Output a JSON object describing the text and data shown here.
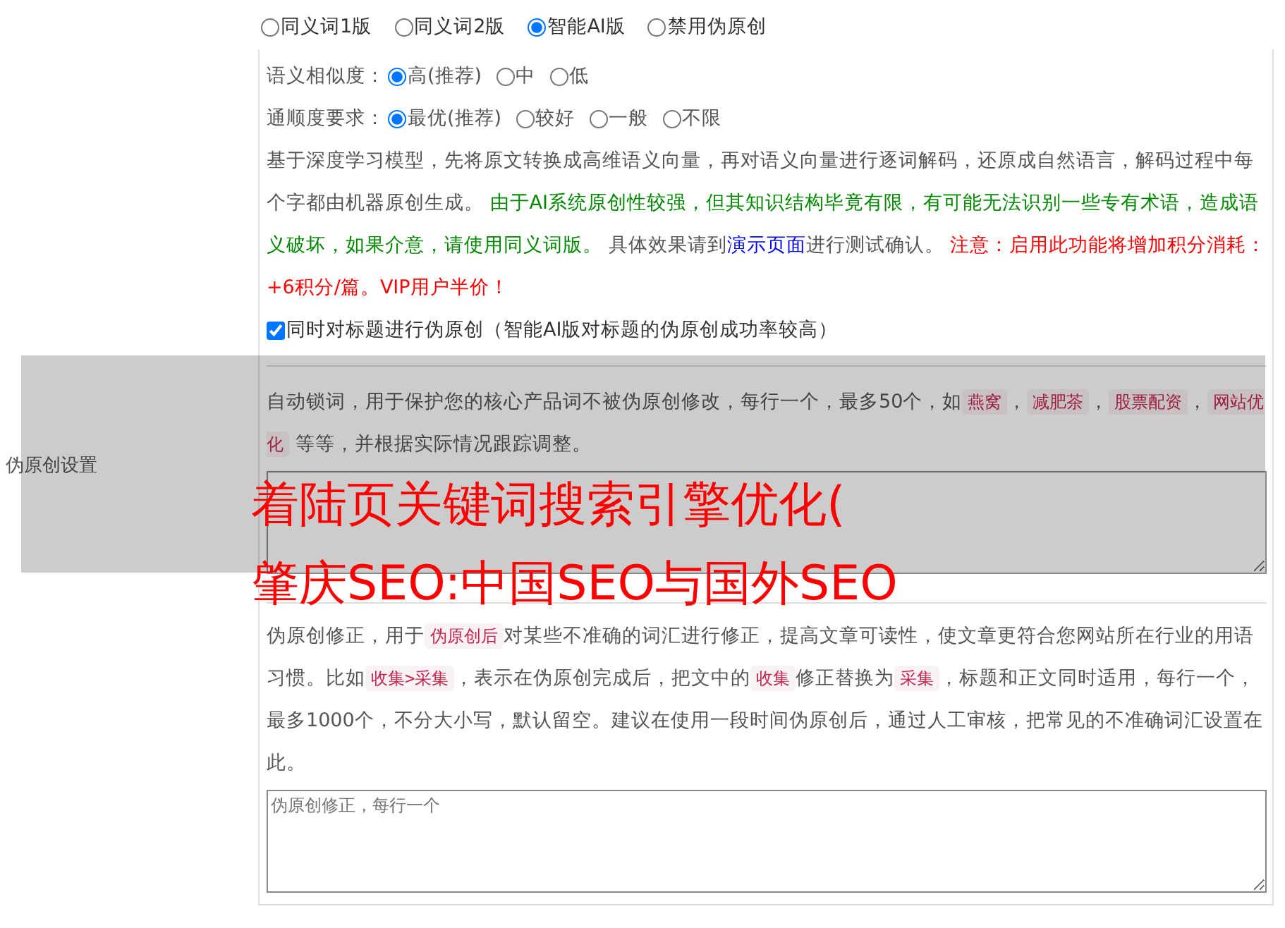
{
  "sidebar_label": "伪原创设置",
  "mode_options": [
    {
      "label": "同义词1版",
      "selected": false
    },
    {
      "label": "同义词2版",
      "selected": false
    },
    {
      "label": "智能AI版",
      "selected": true
    },
    {
      "label": "禁用伪原创",
      "selected": false
    }
  ],
  "similarity": {
    "label": "语义相似度：",
    "options": [
      {
        "label": "高(推荐)",
        "selected": true
      },
      {
        "label": "中",
        "selected": false
      },
      {
        "label": "低",
        "selected": false
      }
    ]
  },
  "fluency": {
    "label": "通顺度要求：",
    "options": [
      {
        "label": "最优(推荐)",
        "selected": true
      },
      {
        "label": "较好",
        "selected": false
      },
      {
        "label": "一般",
        "selected": false
      },
      {
        "label": "不限",
        "selected": false
      }
    ]
  },
  "ai_description": [
    {
      "kind": "text",
      "text": "基于深度学习模型，先将原文转换成高维语义向量，再对语义向量进行逐词解码，还原成自然语言，解码过程中每个字都由机器原创生成。 "
    },
    {
      "kind": "notice",
      "text": "由于AI系统原创性较强，但其知识结构毕竟有限，有可能无法识别一些专有术语，造成语义破坏，如果介意，请使用同义词版。"
    },
    {
      "kind": "text",
      "text": " 具体效果请到"
    },
    {
      "kind": "link",
      "text": "演示页面"
    },
    {
      "kind": "text",
      "text": "进行测试确认。 "
    },
    {
      "kind": "warning",
      "text": "注意：启用此功能将增加积分消耗：+6积分/篇。VIP用户半价！"
    }
  ],
  "title_option": {
    "label": "同时对标题进行伪原创（智能AI版对标题的伪原创成功率较高）",
    "checked": true
  },
  "lock_words": {
    "description": [
      {
        "kind": "text",
        "text": "自动锁词，用于保护您的核心产品词不被伪原创修改，每行一个，最多50个，如"
      },
      {
        "kind": "code",
        "text": "燕窝"
      },
      {
        "kind": "text",
        "text": "，"
      },
      {
        "kind": "code",
        "text": "减肥茶"
      },
      {
        "kind": "text",
        "text": "，"
      },
      {
        "kind": "code",
        "text": "股票配资"
      },
      {
        "kind": "text",
        "text": "，"
      },
      {
        "kind": "code",
        "text": "网站优化"
      },
      {
        "kind": "text",
        "text": " 等等，并根据实际情况跟踪调整。"
      }
    ]
  },
  "corrections": {
    "description": [
      {
        "kind": "text",
        "text": "伪原创修正，用于"
      },
      {
        "kind": "code",
        "text": "伪原创后"
      },
      {
        "kind": "text",
        "text": "对某些不准确的词汇进行修正，提高文章可读性，使文章更符合您网站所在行业的用语习惯。比如"
      },
      {
        "kind": "code",
        "text": "收集>采集"
      },
      {
        "kind": "text",
        "text": "，表示在伪原创完成后，把文中的"
      },
      {
        "kind": "code",
        "text": "收集"
      },
      {
        "kind": "text",
        "text": "修正替换为"
      },
      {
        "kind": "code",
        "text": "采集"
      },
      {
        "kind": "text",
        "text": "，标题和正文同时适用，每行一个，最多1000个，不分大小写，默认留空。建议在使用一段时间伪原创后，通过人工审核，把常见的不准确词汇设置在此。"
      }
    ],
    "placeholder": "伪原创修正，每行一个"
  },
  "overlay_title": [
    "着陆页关键词搜索引擎优化(",
    "肇庆SEO:中国SEO与国外SEO"
  ]
}
